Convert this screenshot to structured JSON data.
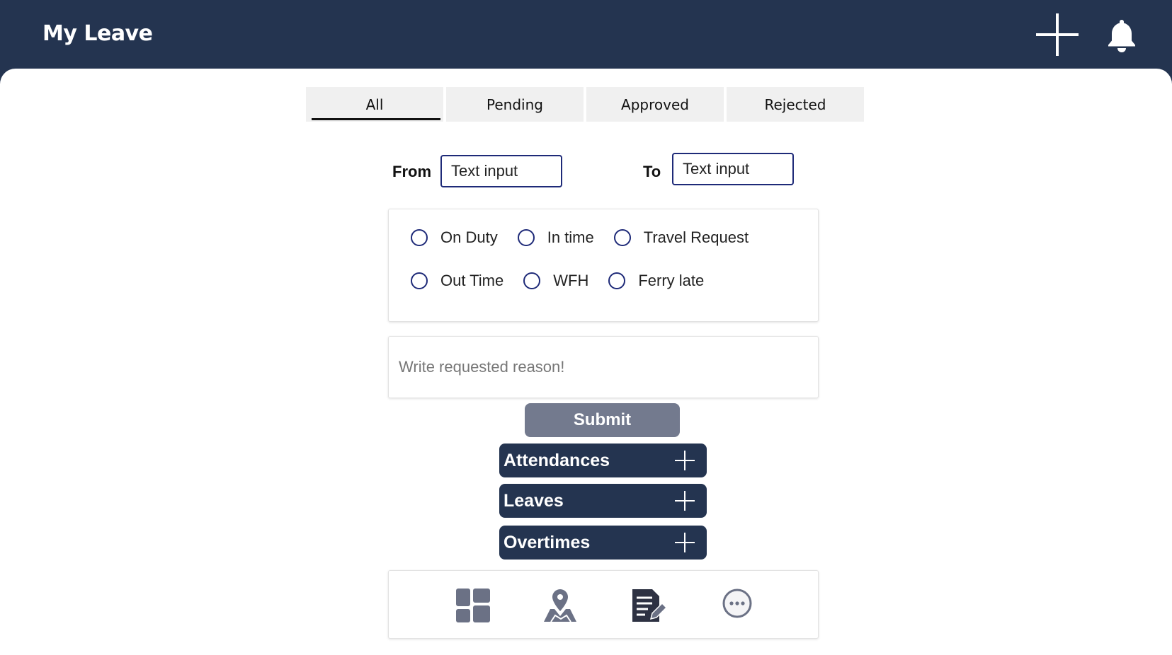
{
  "header": {
    "title": "My Leave"
  },
  "tabs": [
    {
      "label": "All",
      "active": true
    },
    {
      "label": "Pending",
      "active": false
    },
    {
      "label": "Approved",
      "active": false
    },
    {
      "label": "Rejected",
      "active": false
    }
  ],
  "filters": {
    "from_label": "From",
    "from_placeholder": "Text input",
    "to_label": "To",
    "to_placeholder": "Text input"
  },
  "request_types": {
    "row1": [
      "On Duty",
      "In time",
      "Travel Request"
    ],
    "row2": [
      "Out Time",
      "WFH",
      "Ferry late"
    ]
  },
  "reason": {
    "placeholder": "Write requested reason!"
  },
  "submit_label": "Submit",
  "sections": [
    {
      "label": "Attendances"
    },
    {
      "label": "Leaves"
    },
    {
      "label": "Overtimes"
    }
  ],
  "bottom_nav": {
    "icons": [
      "dashboard-icon",
      "map-location-icon",
      "edit-document-icon",
      "more-icon"
    ]
  },
  "colors": {
    "header_bg": "#243450",
    "accent_border": "#1e2a78",
    "submit_bg": "#737a8e",
    "icon_gray": "#6b7185"
  }
}
